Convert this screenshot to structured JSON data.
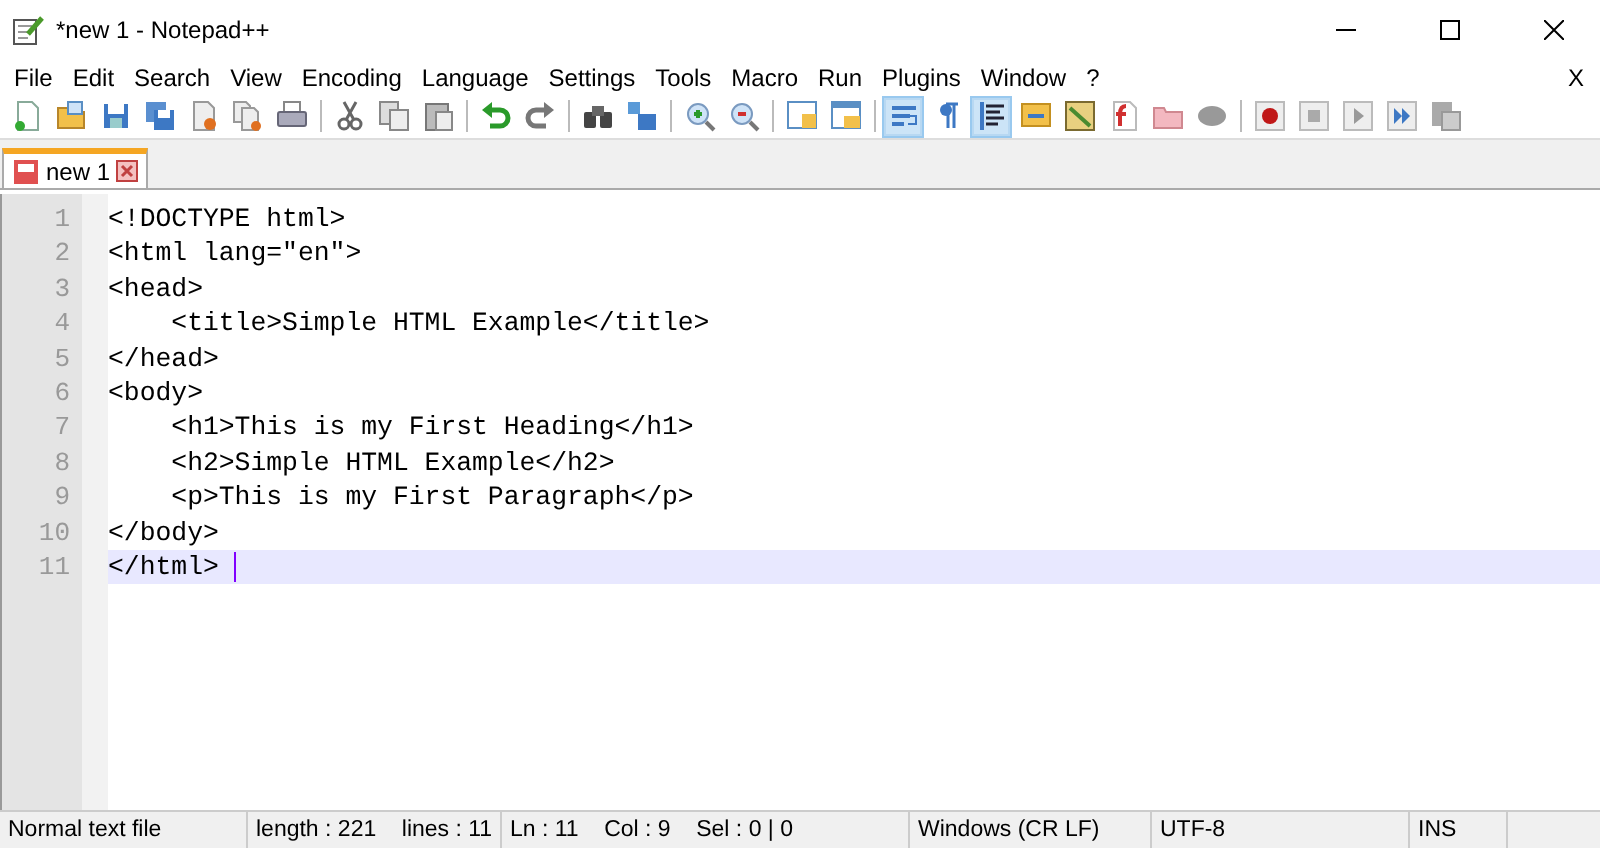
{
  "window": {
    "title": "*new 1 - Notepad++"
  },
  "menu": [
    "File",
    "Edit",
    "Search",
    "View",
    "Encoding",
    "Language",
    "Settings",
    "Tools",
    "Macro",
    "Run",
    "Plugins",
    "Window",
    "?"
  ],
  "menu_close": "X",
  "toolbar": [
    {
      "kind": "new",
      "on": false
    },
    {
      "kind": "open",
      "on": false
    },
    {
      "kind": "save",
      "on": false
    },
    {
      "kind": "saveall",
      "on": false
    },
    {
      "kind": "close",
      "on": false
    },
    {
      "kind": "closeall",
      "on": false
    },
    {
      "kind": "print",
      "on": false
    },
    {
      "kind": "separator"
    },
    {
      "kind": "cut",
      "on": false
    },
    {
      "kind": "copy",
      "on": false
    },
    {
      "kind": "paste",
      "on": false
    },
    {
      "kind": "separator"
    },
    {
      "kind": "undo",
      "on": false
    },
    {
      "kind": "redo",
      "on": false
    },
    {
      "kind": "separator"
    },
    {
      "kind": "find",
      "on": false
    },
    {
      "kind": "replace",
      "on": false
    },
    {
      "kind": "separator"
    },
    {
      "kind": "zoomin",
      "on": false
    },
    {
      "kind": "zoomout",
      "on": false
    },
    {
      "kind": "separator"
    },
    {
      "kind": "syncv",
      "on": false
    },
    {
      "kind": "synch",
      "on": false
    },
    {
      "kind": "separator"
    },
    {
      "kind": "wrap",
      "on": true
    },
    {
      "kind": "pilcrow",
      "on": false
    },
    {
      "kind": "indent",
      "on": true
    },
    {
      "kind": "lang",
      "on": false
    },
    {
      "kind": "map",
      "on": false
    },
    {
      "kind": "func",
      "on": false
    },
    {
      "kind": "folder",
      "on": false
    },
    {
      "kind": "monitor",
      "on": false
    },
    {
      "kind": "separator"
    },
    {
      "kind": "record",
      "on": false
    },
    {
      "kind": "stop",
      "on": false
    },
    {
      "kind": "play",
      "on": false
    },
    {
      "kind": "playmulti",
      "on": false
    },
    {
      "kind": "savemacro",
      "on": false
    }
  ],
  "tabs": [
    {
      "label": "new 1",
      "selected": true
    }
  ],
  "editor": {
    "lines": [
      {
        "number": "1",
        "text": "<!DOCTYPE html>",
        "current": false
      },
      {
        "number": "2",
        "text": "<html lang=\"en\">",
        "current": false
      },
      {
        "number": "3",
        "text": "<head>",
        "current": false
      },
      {
        "number": "4",
        "text": "    <title>Simple HTML Example</title>",
        "current": false
      },
      {
        "number": "5",
        "text": "</head>",
        "current": false
      },
      {
        "number": "6",
        "text": "<body>",
        "current": false
      },
      {
        "number": "7",
        "text": "    <h1>This is my First Heading</h1>",
        "current": false
      },
      {
        "number": "8",
        "text": "    <h2>Simple HTML Example</h2>",
        "current": false
      },
      {
        "number": "9",
        "text": "    <p>This is my First Paragraph</p>",
        "current": false
      },
      {
        "number": "10",
        "text": "</body>",
        "current": false
      },
      {
        "number": "11",
        "text": "</html> ",
        "current": true
      }
    ]
  },
  "status_bar": [
    "Normal text file",
    "length : 221    lines : 11",
    "Ln : 11    Col : 9    Sel : 0 | 0",
    "Windows (CR LF)",
    "UTF-8",
    "INS"
  ]
}
